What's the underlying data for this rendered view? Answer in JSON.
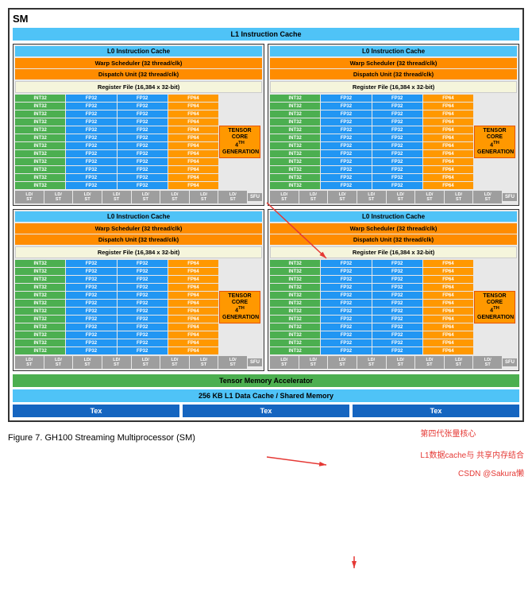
{
  "title": "SM",
  "l1_instruction_cache": "L1 Instruction Cache",
  "quadrants": [
    {
      "l0": "L0 Instruction Cache",
      "warp": "Warp Scheduler (32 thread/clk)",
      "dispatch": "Dispatch Unit (32 thread/clk)",
      "register": "Register File (16,384 x 32-bit)",
      "tensor_label": "TENSOR CORE\n4TH GENERATION",
      "rows": 12,
      "sfu_count": 8
    },
    {
      "l0": "L0 Instruction Cache",
      "warp": "Warp Scheduler (32 thread/clk)",
      "dispatch": "Dispatch Unit (32 thread/clk)",
      "register": "Register File (16,384 x 32-bit)",
      "tensor_label": "TENSOR CORE\n4TH GENERATION",
      "rows": 12,
      "sfu_count": 8
    },
    {
      "l0": "L0 Instruction Cache",
      "warp": "Warp Scheduler (32 thread/clk)",
      "dispatch": "Dispatch Unit (32 thread/clk)",
      "register": "Register File (16,384 x 32-bit)",
      "tensor_label": "TENSOR CORE\n4TH GENERATION",
      "rows": 12,
      "sfu_count": 8
    },
    {
      "l0": "L0 Instruction Cache",
      "warp": "Warp Scheduler (32 thread/clk)",
      "dispatch": "Dispatch Unit (32 thread/clk)",
      "register": "Register File (16,384 x 32-bit)",
      "tensor_label": "TENSOR CORE\n4TH GENERATION",
      "rows": 12,
      "sfu_count": 8
    }
  ],
  "tensor_memory_accelerator": "Tensor Memory Accelerator",
  "l1_data_cache": "256 KB L1 Data Cache / Shared Memory",
  "tex_units": [
    "Tex",
    "Tex",
    "Tex"
  ],
  "figure_caption": "Figure 7.    GH100 Streaming Multiprocessor (SM)",
  "annotations": {
    "fourth_gen": "第四代张量核心",
    "l1_cache": "L1数据cache与\n共享内存结合",
    "csdn": "CSDN @Sakura懒"
  },
  "cell_labels": {
    "int32": "INT32",
    "fp32": "FP32",
    "fp64": "FP64",
    "ld_st": "LD/\nST",
    "sfu": "SFU"
  }
}
